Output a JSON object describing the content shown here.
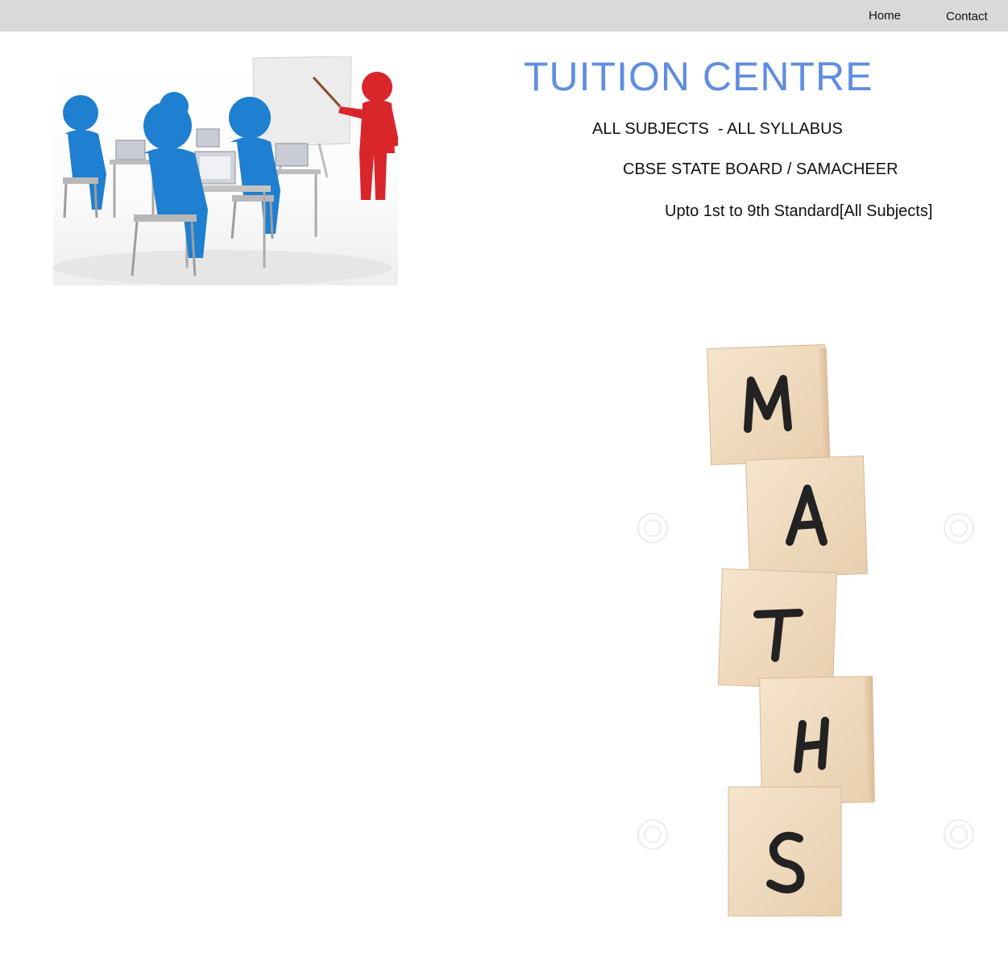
{
  "nav": {
    "home_label": "Home",
    "contact_label": "Contact"
  },
  "header": {
    "title": "TUITION CENTRE",
    "subjects_line": "ALL SUBJECTS  - ALL SYLLABUS",
    "boards_line": "CBSE STATE BOARD / SAMACHEER",
    "standard_line": "Upto 1st to 9th Standard[All Subjects]"
  },
  "maths_image": {
    "letters": [
      "M",
      "A",
      "T",
      "H",
      "S"
    ]
  },
  "colors": {
    "nav_bar": "#d9d9d9",
    "title_blue": "#5f8de0",
    "student_blue": "#1f7fd0",
    "teacher_red": "#d8262b",
    "block_wood": "#f2dcc0"
  },
  "icons": {
    "classroom_image": "classroom-illustration",
    "maths_image": "maths-blocks-photo"
  }
}
